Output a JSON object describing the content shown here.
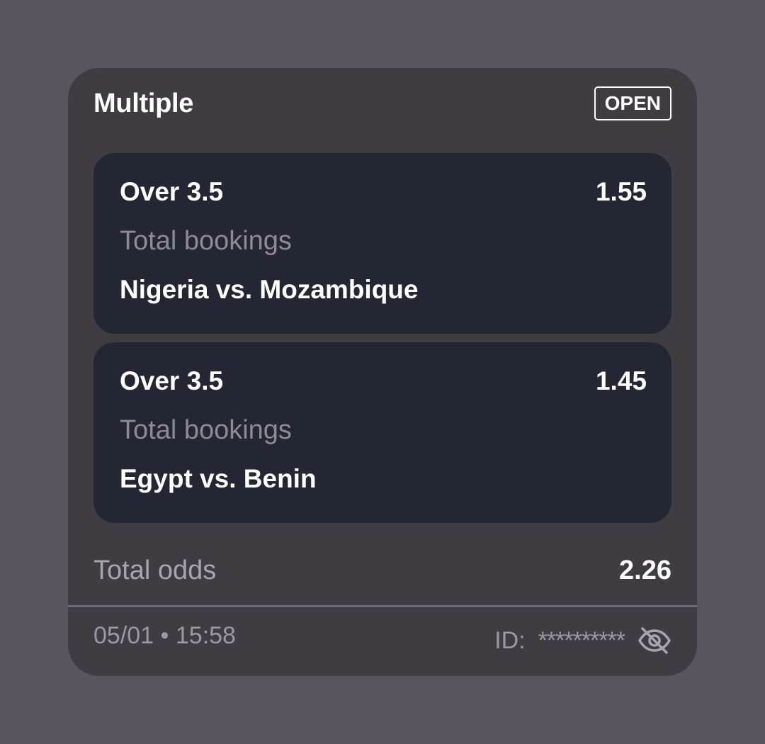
{
  "bet": {
    "title": "Multiple",
    "status": "OPEN",
    "selections": [
      {
        "outcome": "Over 3.5",
        "odds": "1.55",
        "market": "Total bookings",
        "event": "Nigeria vs. Mozambique"
      },
      {
        "outcome": "Over 3.5",
        "odds": "1.45",
        "market": "Total bookings",
        "event": "Egypt vs. Benin"
      }
    ],
    "total_odds_label": "Total odds",
    "total_odds_value": "2.26",
    "timestamp": "05/01 • 15:58",
    "id_label": "ID:",
    "id_value": "**********",
    "visibility_icon": "eye-off-icon"
  },
  "colors": {
    "page_background": "#58555f",
    "card_background": "#403d42",
    "selection_background": "#232733",
    "muted_text": "#8c8b92"
  }
}
